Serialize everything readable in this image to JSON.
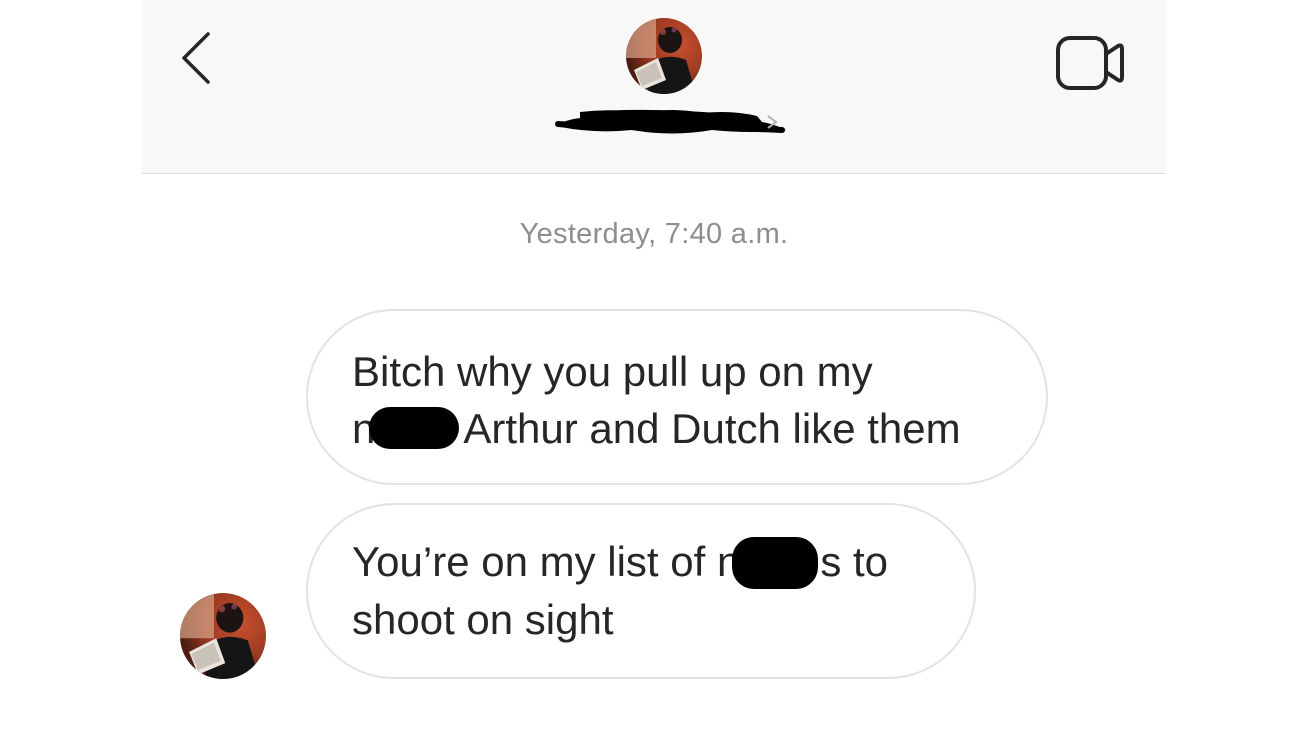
{
  "header": {
    "back_icon": "chevron-left-icon",
    "video_icon": "video-camera-icon",
    "avatar": "profile-photo"
  },
  "messages": {
    "timestamp_1": "Yesterday, 7:40 a.m.",
    "bubble_1": {
      "line_1": "Bitch why you pull up on my",
      "line_2_prefix": "n",
      "line_2_suffix": "Arthur and Dutch like them"
    },
    "bubble_2": {
      "line_1_prefix": "You’re on my list of n",
      "line_1_suffix": "s to",
      "line_2": "shoot on sight"
    }
  },
  "colors": {
    "header_bg": "#f8f8f8",
    "bubble_border": "#e3e3e3",
    "timestamp": "#8e8e8e",
    "text": "#262626"
  }
}
